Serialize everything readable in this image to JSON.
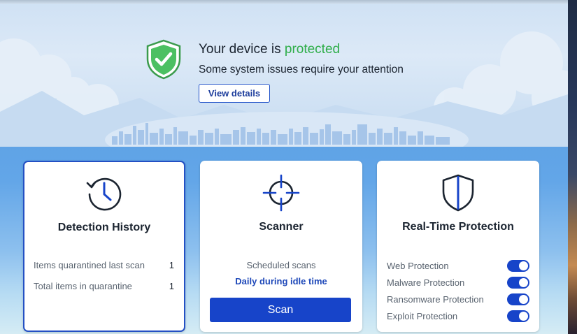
{
  "hero": {
    "title_prefix": "Your device is",
    "title_status": "protected",
    "subtitle": "Some system issues require your attention",
    "view_details_label": "View details",
    "shield_icon": "shield-check-icon",
    "status_color": "#2fae4a"
  },
  "cards": {
    "detection_history": {
      "title": "Detection History",
      "icon": "clock-history-icon",
      "rows": [
        {
          "label": "Items quarantined last scan",
          "value": "1"
        },
        {
          "label": "Total items in quarantine",
          "value": "1"
        }
      ]
    },
    "scanner": {
      "title": "Scanner",
      "icon": "crosshair-icon",
      "schedule_label": "Scheduled scans",
      "schedule_value": "Daily during idle time",
      "scan_button_label": "Scan"
    },
    "realtime": {
      "title": "Real-Time Protection",
      "icon": "shield-icon",
      "items": [
        {
          "label": "Web Protection",
          "enabled": true
        },
        {
          "label": "Malware Protection",
          "enabled": true
        },
        {
          "label": "Ransomware Protection",
          "enabled": true
        },
        {
          "label": "Exploit Protection",
          "enabled": true
        }
      ]
    }
  },
  "colors": {
    "accent": "#1744c9",
    "selected_border": "#2350c4",
    "text": "#1b2430",
    "muted": "#5a6470"
  }
}
